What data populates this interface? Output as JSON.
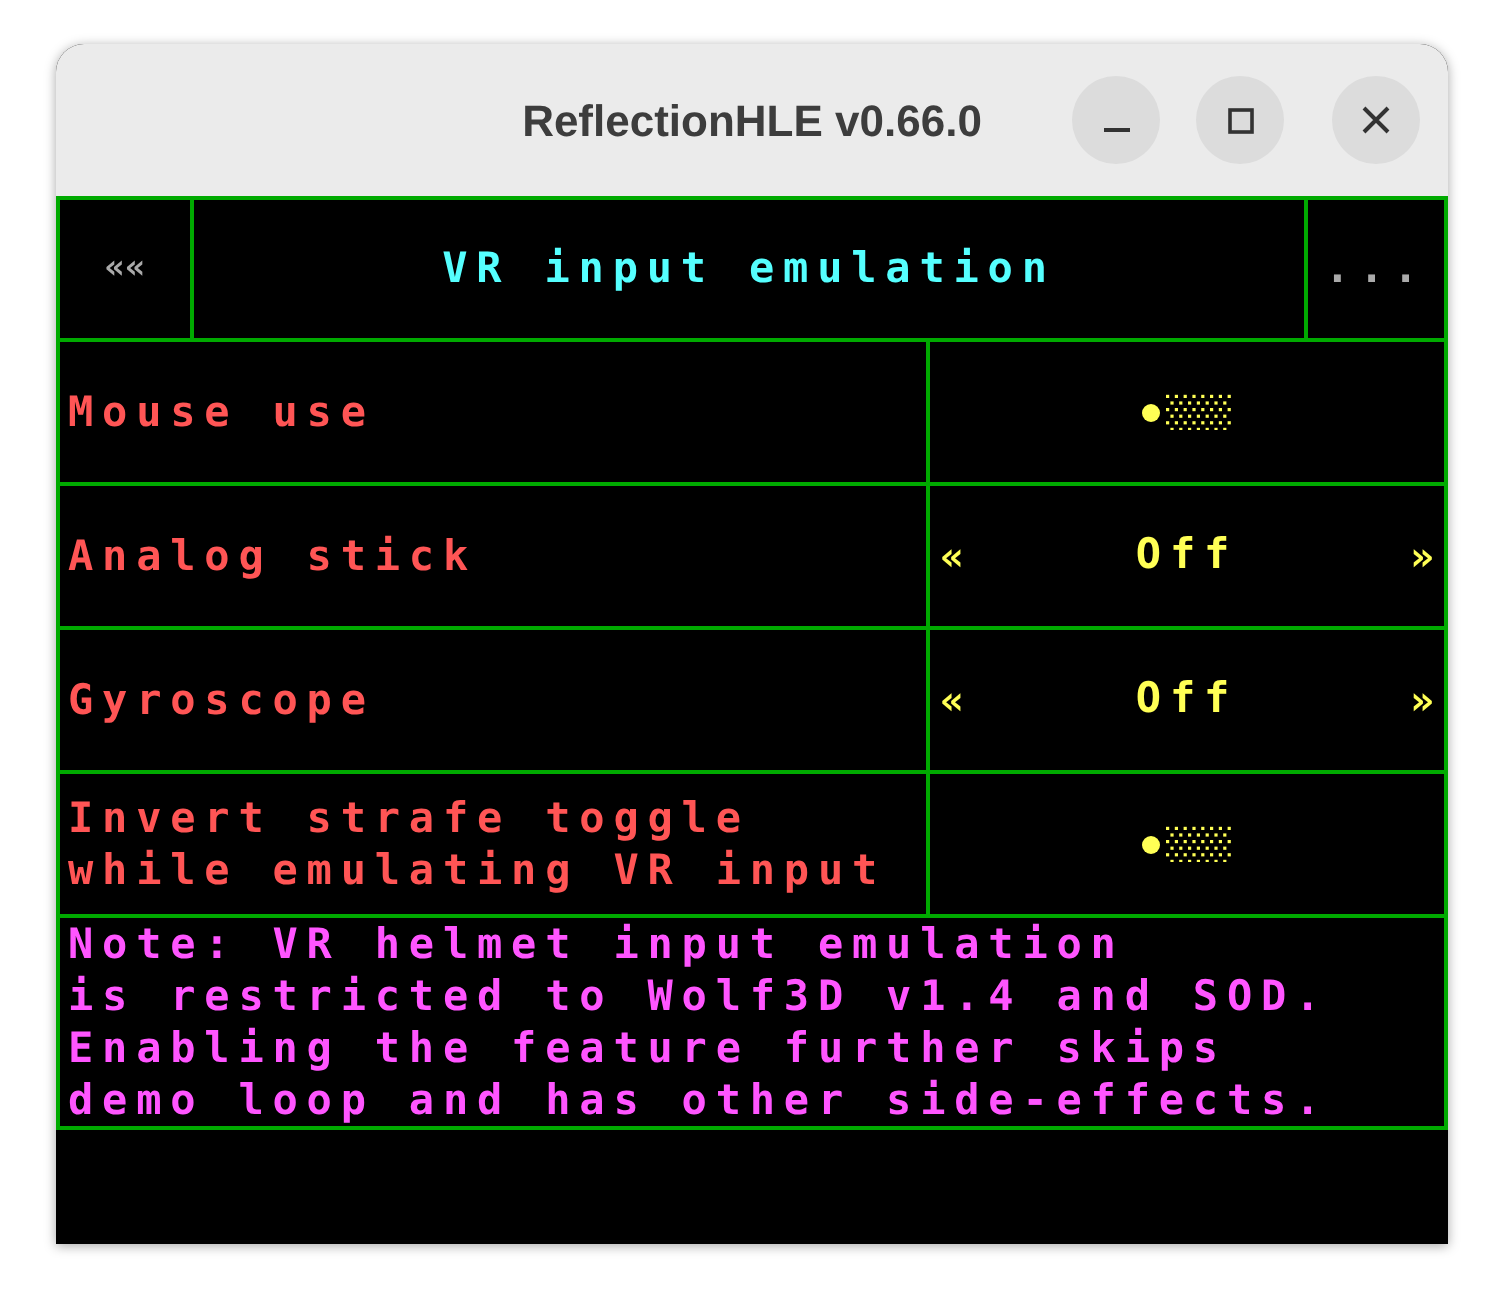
{
  "window": {
    "title": "ReflectionHLE v0.66.0"
  },
  "header": {
    "back": "««",
    "title": "VR input emulation",
    "more": "..."
  },
  "settings": [
    {
      "label": "Mouse use",
      "kind": "slider",
      "level": 0
    },
    {
      "label": "Analog stick",
      "kind": "choice",
      "prev": "«",
      "value": "Off",
      "next": "»"
    },
    {
      "label": "Gyroscope",
      "kind": "choice",
      "prev": "«",
      "value": "Off",
      "next": "»"
    },
    {
      "label": "Invert strafe toggle\nwhile emulating VR input",
      "kind": "slider",
      "level": 0
    }
  ],
  "note": "Note: VR helmet input emulation\nis restricted to Wolf3D v1.4 and SOD.\nEnabling the feature further skips\ndemo loop and has other side-effects."
}
